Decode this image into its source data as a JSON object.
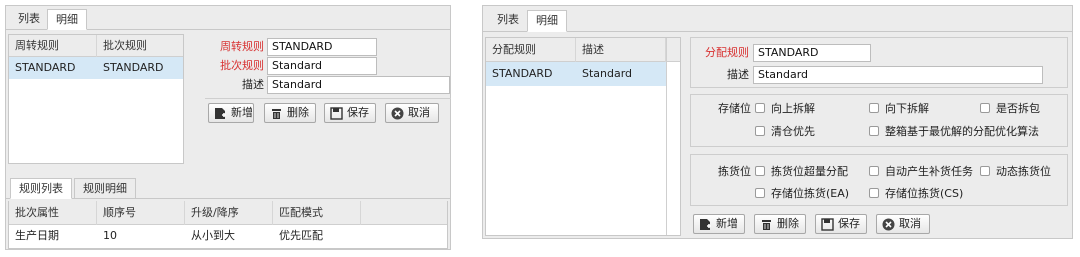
{
  "left": {
    "tabs": [
      {
        "label": "列表"
      },
      {
        "label": "明细"
      }
    ],
    "grid": {
      "headers": [
        "周转规则",
        "批次规则"
      ],
      "rows": [
        [
          "STANDARD",
          "STANDARD"
        ]
      ]
    },
    "form": {
      "fields": [
        {
          "label": "周转规则",
          "value": "STANDARD",
          "required": true
        },
        {
          "label": "批次规则",
          "value": "Standard",
          "required": true
        },
        {
          "label": "描述",
          "value": "Standard",
          "required": false
        }
      ]
    },
    "buttons": {
      "add": "新增",
      "delete": "删除",
      "save": "保存",
      "cancel": "取消"
    },
    "bottom_tabs": [
      {
        "label": "规则列表"
      },
      {
        "label": "规则明细"
      }
    ],
    "bottom_grid": {
      "headers": [
        "批次属性",
        "顺序号",
        "升级/降序",
        "匹配模式"
      ],
      "rows": [
        [
          "生产日期",
          "10",
          "从小到大",
          "优先匹配"
        ]
      ]
    }
  },
  "right": {
    "tabs": [
      {
        "label": "列表"
      },
      {
        "label": "明细"
      }
    ],
    "grid": {
      "headers": [
        "分配规则",
        "描述"
      ],
      "rows": [
        [
          "STANDARD",
          "Standard"
        ]
      ]
    },
    "form": {
      "fields": [
        {
          "label": "分配规则",
          "value": "STANDARD",
          "required": true
        },
        {
          "label": "描述",
          "value": "Standard",
          "required": false
        }
      ]
    },
    "storage": {
      "label": "存储位",
      "options": [
        "向上拆解",
        "向下拆解",
        "是否拆包",
        "清仓优先",
        "整箱基于最优解的分配优化算法"
      ]
    },
    "picking": {
      "label": "拣货位",
      "options": [
        "拣货位超量分配",
        "自动产生补货任务",
        "动态拣货位",
        "存储位拣货(EA)",
        "存储位拣货(CS)"
      ]
    },
    "buttons": {
      "add": "新增",
      "delete": "删除",
      "save": "保存",
      "cancel": "取消"
    }
  },
  "colors": {
    "required_label": "#d83030",
    "selected_row": "#d5e8f6"
  }
}
